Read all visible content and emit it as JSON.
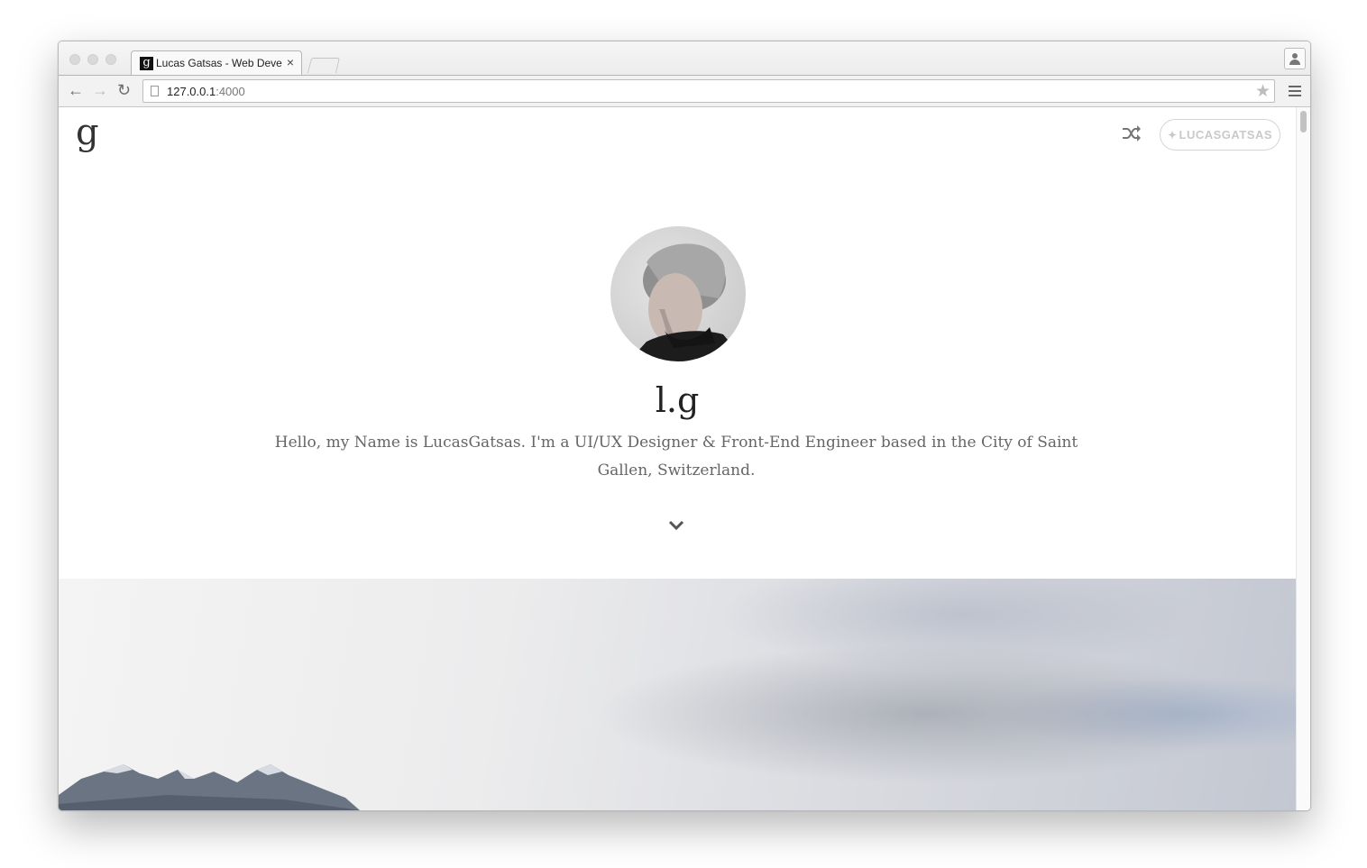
{
  "browser": {
    "tab": {
      "favicon_letter": "g",
      "title": "Lucas Gatsas - Web Developer",
      "close": "×"
    },
    "url": {
      "host": "127.0.0.1",
      "port": ":4000"
    }
  },
  "site": {
    "logo": "g",
    "twitter_icon": "twitter-icon",
    "twitter_handle": "LUCASGATSAS",
    "shuffle_icon": "shuffle-icon"
  },
  "hero": {
    "title": "l.g",
    "intro": "Hello, my Name is LucasGatsas. I'm a UI/UX Designer & Front-End Engineer based in the City of Saint Gallen, Switzerland.",
    "scroll_icon": "chevron-down-icon"
  },
  "colors": {
    "text_dark": "#222222",
    "text_muted": "#666666",
    "button_border": "#d5d5d5"
  }
}
